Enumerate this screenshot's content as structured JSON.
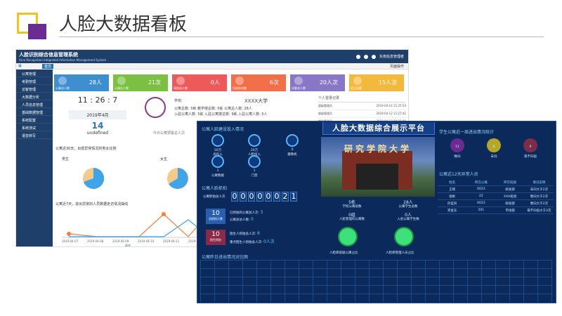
{
  "slide": {
    "title": "人脸大数据看板"
  },
  "s1": {
    "app_title": "人脸识别综合信息管理系统",
    "app_sub": "Face Recognition Integrated Information Management System",
    "user": "东南信息管理者",
    "tab_home": "首页",
    "action": "页面操作",
    "menu": [
      "公寓管理",
      "考勤管理",
      "访客管理",
      "大数据分析",
      "人员信息管理",
      "基础数据管理",
      "系统配置",
      "系统测试",
      "语音转写"
    ],
    "cards": [
      {
        "label": "公寓总人数",
        "value": "28人",
        "color": "#3f8ed0"
      },
      {
        "label": "公寓总人数",
        "value": "21次",
        "color": "#7bc043"
      },
      {
        "label": "离校总人数",
        "value": "0人",
        "color": "#ee5a5a"
      },
      {
        "label": "归校总次数",
        "value": "6次",
        "color": "#f26f4a"
      },
      {
        "label": "访客总人数",
        "value": "20人次",
        "color": "#8a76c7"
      },
      {
        "label": "近日访客",
        "value": "15人次",
        "color": "#f3b93c"
      }
    ],
    "clock": {
      "h": "11",
      "m": "26",
      "s": "7",
      "date": "2019年4月",
      "day": "14",
      "sub": "undefined"
    },
    "profile": {
      "school_label": "学校:",
      "school": "XXXX大学",
      "row1": "公寓总数:  5栋      教学楼总数:  5栋      公寓总人数:  28人",
      "row2": "入驻公寓人数:  5栋   入驻公寓楼总数:  9栋   入驻公寓人数:  5人"
    },
    "today": "今日公寓预警总人次",
    "log_title": "个人登录记录",
    "log": [
      [
        "超级管理员",
        "2019-04-14 11:25:54"
      ],
      [
        "超级管理员",
        "2019-04-12 11:27:41"
      ],
      [
        "超级管理员",
        "2019-04-12 10:27:40"
      ]
    ],
    "pie_title": "公寓近30天，出现异常情况的男女比例",
    "pie_a": "男生",
    "pie_b": "女生",
    "line_title": "公寓近7天，进出异常的人员数据走访情况曲线",
    "line_dates": [
      "2019-04-07",
      "2019-04-08",
      "2019-04-09",
      "2019-04-10",
      "2019-04-11",
      "2019-04-12"
    ],
    "line_legend": "离校"
  },
  "s2": {
    "title": "人脸大数据综合展示平台",
    "sec_a": "公寓人脸建设投入情况",
    "icons": [
      {
        "v": "50万",
        "l": "总投入"
      },
      {
        "v": "20万",
        "l": "人脸投入"
      },
      {
        "v": "0",
        "l": "摄像机"
      },
      {
        "v": "1",
        "l": "公寓数据"
      },
      {
        "v": "1",
        "l": "门禁"
      }
    ],
    "sec_b": "公寓人脸抓拍",
    "total_label": "公寓抓拍总人次",
    "digits": [
      "0",
      "0",
      "0",
      "0",
      "0",
      "0",
      "2",
      "1"
    ],
    "m1": {
      "v": "10",
      "l": "总抓拍人数",
      "a": "已抓拍的公寓总人次:",
      "av": "3",
      "b": "公寓总访人数:",
      "bv": "0"
    },
    "m2": {
      "v": "10",
      "l": "陌生抓拍",
      "a": "陌生人抓拍总人次:",
      "av": "8",
      "b": "重点陌生人抓拍总人次:",
      "bv": "0人次"
    },
    "mid": [
      {
        "v": "5栋",
        "l": "学校公寓总数"
      },
      {
        "v": "28人",
        "l": "公寓学生总数"
      },
      {
        "v": "0组",
        "l": "人脸管理的公寓数"
      },
      {
        "v": "0人",
        "l": "入驻公寓学生数"
      }
    ],
    "g1": "人脸库班级公寓占比",
    "g2": "人脸库管理人员占比",
    "sec_c": "学生公寓近一周进出情况统计",
    "av": [
      {
        "v": "11",
        "l": "晚归"
      },
      {
        "v": "8",
        "l": "未归"
      },
      {
        "v": "9",
        "l": "夜不归宿"
      }
    ],
    "sec_d": "公寓近12天异常人员",
    "head": [
      "姓名",
      "所在公寓",
      "所在班级",
      "情况说明"
    ],
    "rows": [
      [
        "王晓",
        "6023",
        "研发部",
        "未归大于2次"
      ],
      [
        "张彬",
        "22",
        "XXX班组",
        "晚归大于2次"
      ],
      [
        "孙蓝同",
        "6023",
        "研发部",
        "晚归大于2次"
      ],
      [
        "李金东",
        "501",
        "市场部",
        "夜不归宿大于2次"
      ]
    ],
    "sec_e": "公寓昨日进出情况对比图"
  }
}
